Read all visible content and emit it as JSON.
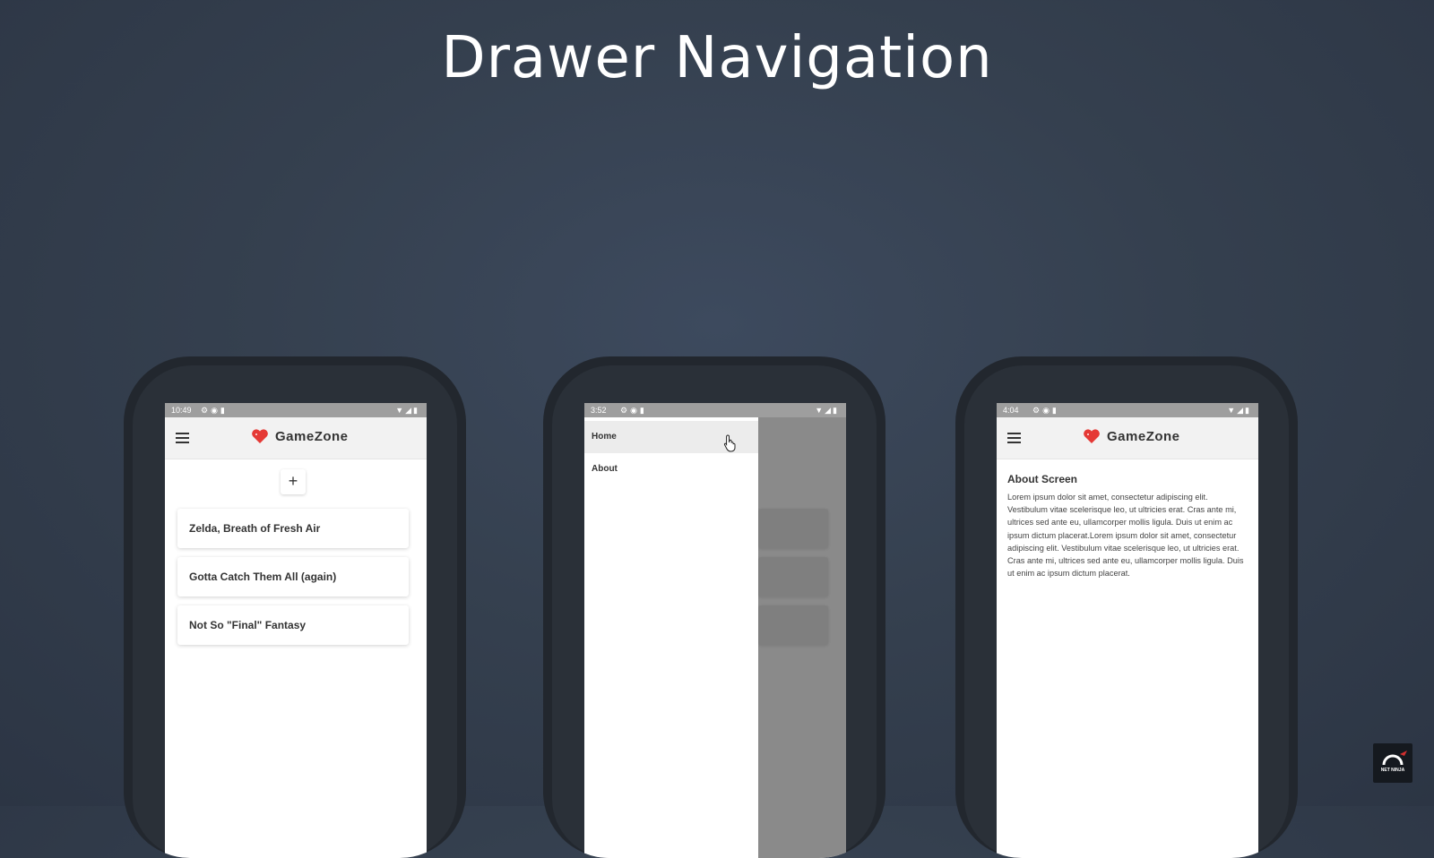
{
  "title": "Drawer Navigation",
  "phones": [
    {
      "status": {
        "time": "10:49"
      },
      "header": {
        "brand": "GameZone"
      },
      "add_label": "+",
      "reviews": [
        "Zelda, Breath of Fresh Air",
        "Gotta Catch Them All (again)",
        "Not So \"Final\" Fantasy"
      ]
    },
    {
      "status": {
        "time": "3:52"
      },
      "drawer": [
        {
          "label": "Home",
          "active": true
        },
        {
          "label": "About",
          "active": false
        }
      ]
    },
    {
      "status": {
        "time": "4:04"
      },
      "header": {
        "brand": "GameZone"
      },
      "about": {
        "title": "About Screen",
        "body": "Lorem ipsum dolor sit amet, consectetur adipiscing elit. Vestibulum vitae scelerisque leo, ut ultricies erat. Cras ante mi, ultrices sed ante eu, ullamcorper mollis ligula. Duis ut enim ac ipsum dictum placerat.Lorem ipsum dolor sit amet, consectetur adipiscing elit. Vestibulum vitae scelerisque leo, ut ultricies erat. Cras ante mi, ultrices sed ante eu, ullamcorper mollis ligula. Duis ut enim ac ipsum dictum placerat."
      }
    }
  ],
  "logo": {
    "text": "NET NINJA"
  },
  "colors": {
    "background": "#35404f",
    "status_bar": "#9e9e9e",
    "header": "#f2f2f2",
    "heart": "#e53935",
    "overlay": "#8a8a8a"
  },
  "icons": [
    "menu-icon",
    "heart-icon",
    "plus-icon",
    "settings-icon",
    "wifi-icon",
    "signal-icon",
    "battery-icon",
    "hand-cursor-icon"
  ]
}
